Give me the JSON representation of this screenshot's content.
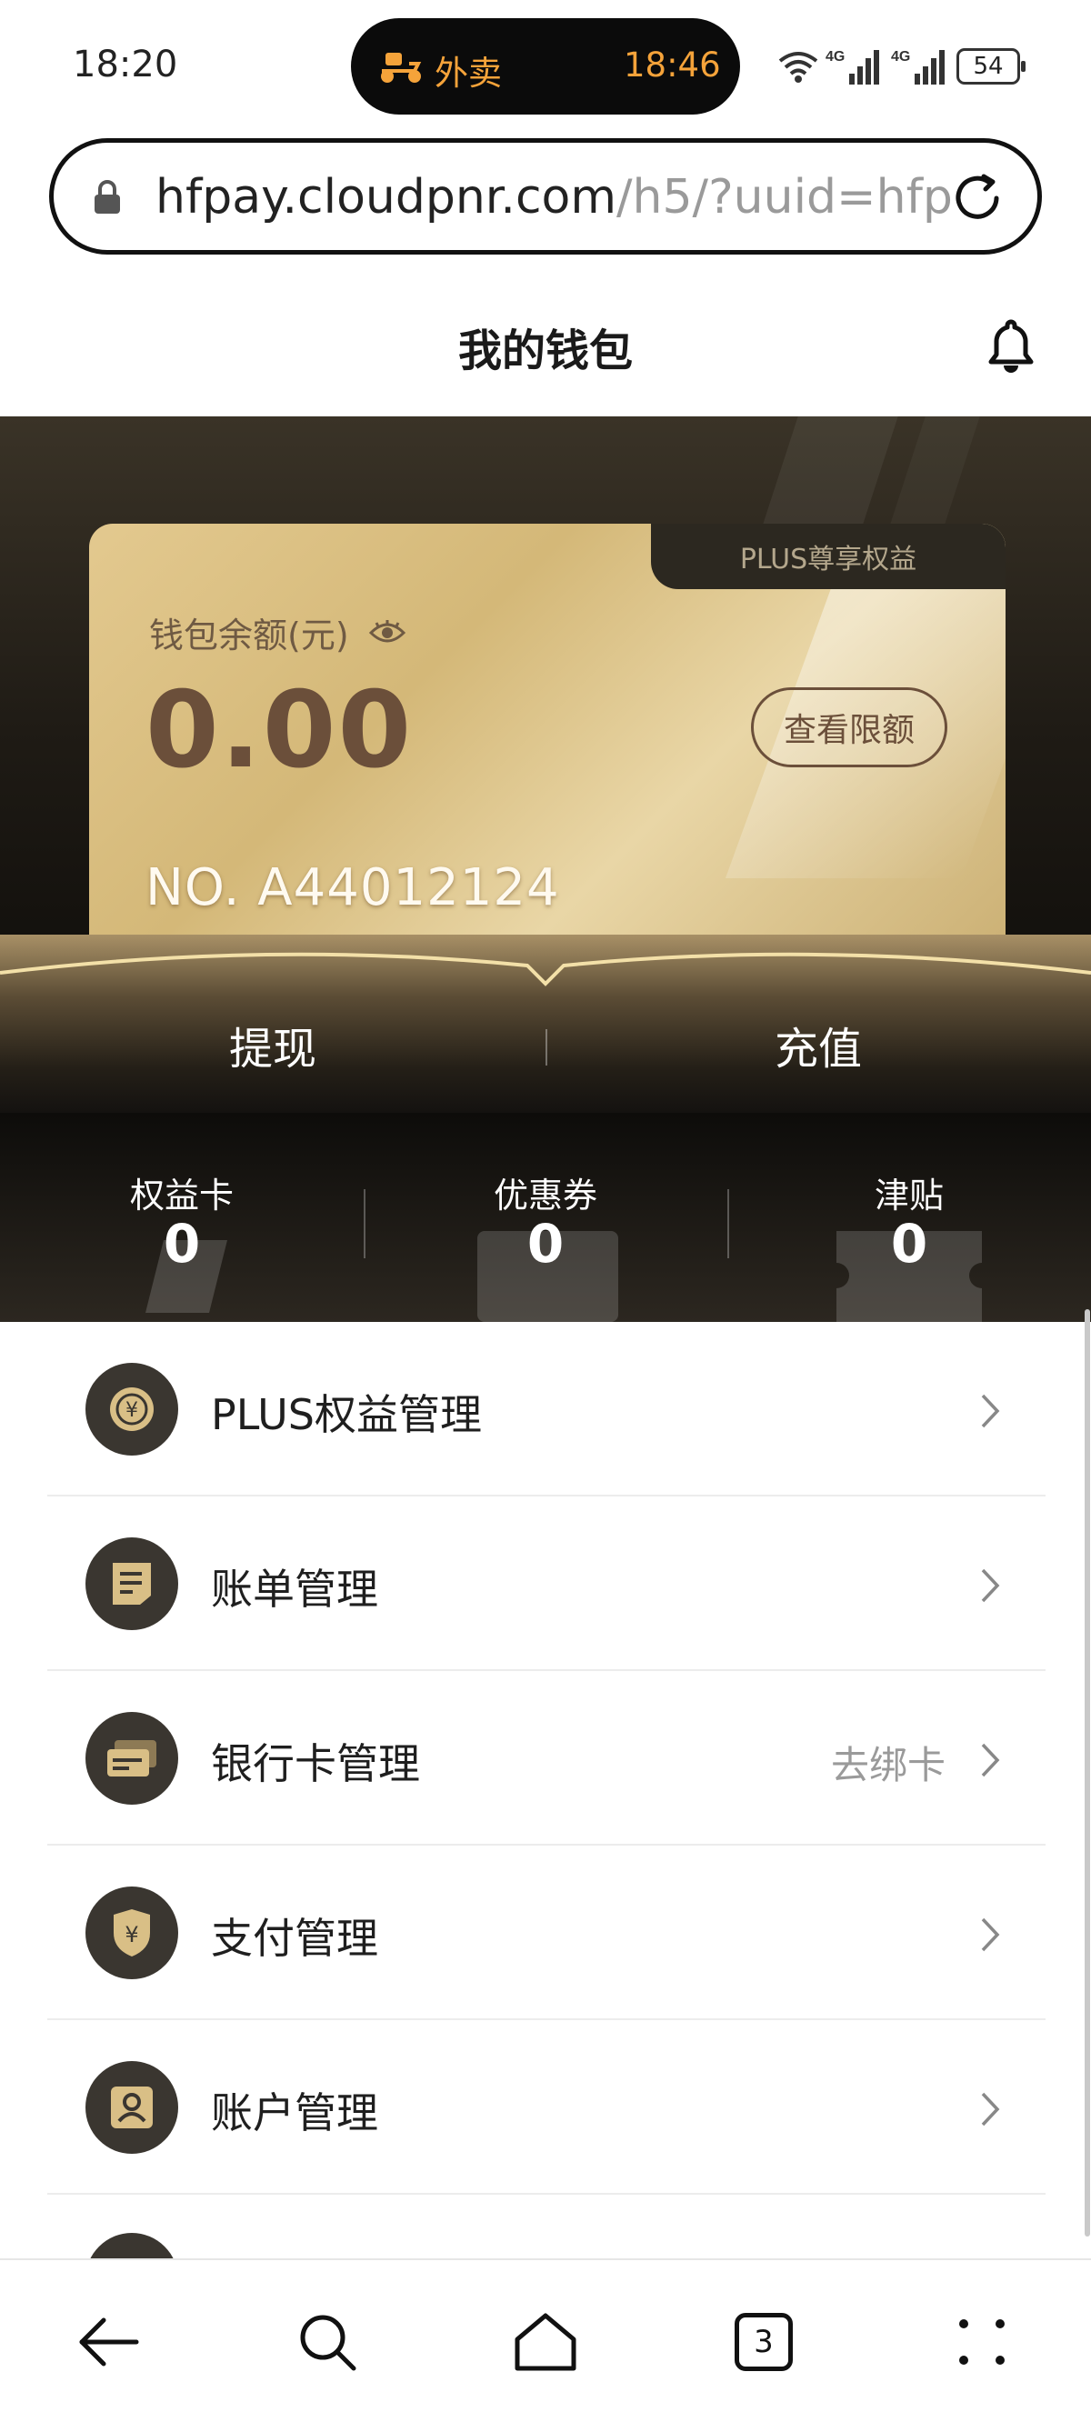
{
  "status_bar": {
    "time": "18:20",
    "island": {
      "label": "外卖",
      "time": "18:46"
    },
    "network_1": "4G",
    "network_2": "4G",
    "battery": "54"
  },
  "browser": {
    "url_host": "hfpay.cloudpnr.com",
    "url_path": "/h5/?uuid=hfp",
    "tab_count": "3"
  },
  "header": {
    "title": "我的钱包"
  },
  "wallet": {
    "tag": "PLUS尊享权益",
    "balance_label": "钱包余额(元)",
    "balance": "0.00",
    "limit_button": "查看限额",
    "card_no": "NO. A44012124",
    "withdraw": "提现",
    "recharge": "充值"
  },
  "stats": [
    {
      "label": "权益卡",
      "value": "0"
    },
    {
      "label": "优惠券",
      "value": "0"
    },
    {
      "label": "津贴",
      "value": "0"
    }
  ],
  "menu": [
    {
      "label": "PLUS权益管理",
      "extra": "",
      "icon": "plus-coin-icon"
    },
    {
      "label": "账单管理",
      "extra": "",
      "icon": "bill-icon"
    },
    {
      "label": "银行卡管理",
      "extra": "去绑卡",
      "icon": "bank-card-icon"
    },
    {
      "label": "支付管理",
      "extra": "",
      "icon": "payment-shield-icon"
    },
    {
      "label": "账户管理",
      "extra": "",
      "icon": "account-icon"
    }
  ],
  "colors": {
    "gold_card": "#d4b878",
    "brown_text": "#6b4f3a",
    "hero_dark": "#1f1b15",
    "menu_icon_bg": "#3a3630"
  }
}
